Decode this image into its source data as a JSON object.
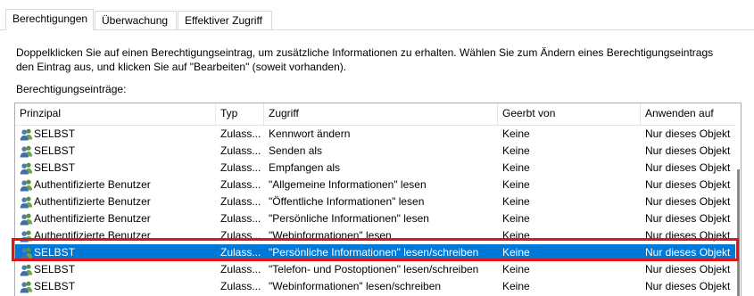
{
  "tabs": [
    {
      "label": "Berechtigungen",
      "active": true
    },
    {
      "label": "Überwachung",
      "active": false
    },
    {
      "label": "Effektiver Zugriff",
      "active": false
    }
  ],
  "description": "Doppelklicken Sie auf einen Berechtigungseintrag, um zusätzliche Informationen zu erhalten. Wählen Sie zum Ändern eines Berechtigungseintrags den Eintrag aus, und klicken Sie auf \"Bearbeiten\" (soweit vorhanden).",
  "entries_label": "Berechtigungseinträge:",
  "columns": {
    "principal": "Prinzipal",
    "typ": "Typ",
    "zugriff": "Zugriff",
    "geerbt": "Geerbt von",
    "anwenden": "Anwenden auf"
  },
  "rows": [
    {
      "principal": "SELBST",
      "typ": "Zulass...",
      "zugriff": "Kennwort ändern",
      "geerbt": "Keine",
      "anwenden": "Nur dieses Objekt"
    },
    {
      "principal": "SELBST",
      "typ": "Zulass...",
      "zugriff": "Senden als",
      "geerbt": "Keine",
      "anwenden": "Nur dieses Objekt"
    },
    {
      "principal": "SELBST",
      "typ": "Zulass...",
      "zugriff": "Empfangen als",
      "geerbt": "Keine",
      "anwenden": "Nur dieses Objekt"
    },
    {
      "principal": "Authentifizierte Benutzer",
      "typ": "Zulass...",
      "zugriff": "\"Allgemeine Informationen\" lesen",
      "geerbt": "Keine",
      "anwenden": "Nur dieses Objekt"
    },
    {
      "principal": "Authentifizierte Benutzer",
      "typ": "Zulass...",
      "zugriff": "\"Öffentliche Informationen\" lesen",
      "geerbt": "Keine",
      "anwenden": "Nur dieses Objekt"
    },
    {
      "principal": "Authentifizierte Benutzer",
      "typ": "Zulass...",
      "zugriff": "\"Persönliche Informationen\" lesen",
      "geerbt": "Keine",
      "anwenden": "Nur dieses Objekt"
    },
    {
      "principal": "Authentifizierte Benutzer",
      "typ": "Zulass...",
      "zugriff": "\"Webinformationen\" lesen",
      "geerbt": "Keine",
      "anwenden": "Nur dieses Objekt"
    },
    {
      "principal": "SELBST",
      "typ": "Zulass...",
      "zugriff": "\"Persönliche Informationen\" lesen/schreiben",
      "geerbt": "Keine",
      "anwenden": "Nur dieses Objekt",
      "selected": true
    },
    {
      "principal": "SELBST",
      "typ": "Zulass...",
      "zugriff": "\"Telefon- und Postoptionen\" lesen/schreiben",
      "geerbt": "Keine",
      "anwenden": "Nur dieses Objekt"
    },
    {
      "principal": "SELBST",
      "typ": "Zulass...",
      "zugriff": "\"Webinformationen\" lesen/schreiben",
      "geerbt": "Keine",
      "anwenden": "Nur dieses Objekt"
    }
  ],
  "colors": {
    "selection": "#0078d7",
    "highlight_box": "#e0141b"
  },
  "icons": {
    "principal": "user-group-icon"
  }
}
